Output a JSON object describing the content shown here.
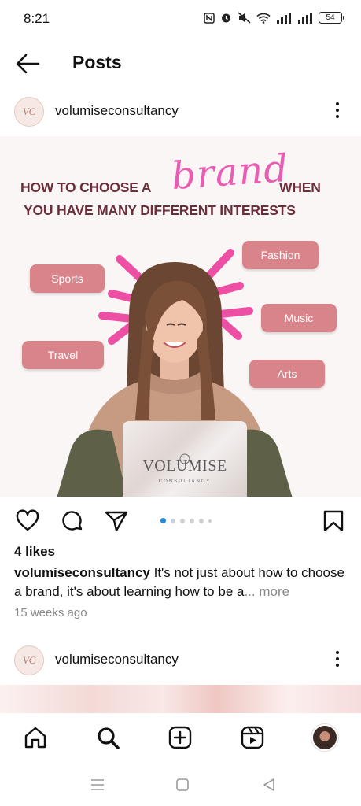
{
  "status_bar": {
    "time": "8:21",
    "battery": "54",
    "icons": [
      "nfc-icon",
      "alarm-icon",
      "mute-icon",
      "wifi-icon",
      "signal-icon",
      "signal-icon",
      "battery-icon"
    ]
  },
  "header": {
    "title": "Posts",
    "back_icon": "arrow-left-icon"
  },
  "post": {
    "username": "volumiseconsultancy",
    "avatar_text": "VC",
    "image": {
      "headline_part1": "HOW TO CHOOSE A",
      "headline_script": "brand",
      "headline_part2": "WHEN",
      "headline_line2": "YOU HAVE MANY DIFFERENT INTERESTS",
      "tags": [
        "Sports",
        "Fashion",
        "Music",
        "Travel",
        "Arts"
      ],
      "laptop_brand": "VOLUMISE",
      "laptop_sub": "CONSULTANCY"
    },
    "carousel": {
      "count": 6,
      "active_index": 0
    },
    "likes": "4 likes",
    "caption_user": "volumiseconsultancy",
    "caption_text": " It's not just about how to choose a brand, it's about learning how to be a",
    "caption_more": "... more",
    "timestamp": "15 weeks ago"
  },
  "next_post": {
    "username": "volumiseconsultancy",
    "avatar_text": "VC"
  },
  "bottom_nav": {
    "items": [
      "home-icon",
      "search-icon",
      "create-icon",
      "reels-icon",
      "profile-avatar"
    ]
  },
  "colors": {
    "accent_blue": "#2b88d9",
    "headline": "#6b2e3a",
    "script_pink": "#e85db3",
    "tag_bg": "#d9848b"
  }
}
